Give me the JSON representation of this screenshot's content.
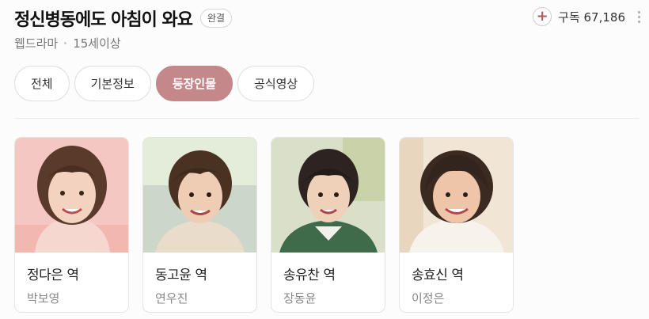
{
  "header": {
    "title": "정신병동에도 아침이 와요",
    "badge": "완결",
    "genre": "웹드라마",
    "rating": "15세이상",
    "subscribe_label": "구독 67,186",
    "subscribe_icon": "plus-icon",
    "more_icon": "more-vertical-icon"
  },
  "tabs": [
    {
      "label": "전체"
    },
    {
      "label": "기본정보"
    },
    {
      "label": "등장인물",
      "active": true
    },
    {
      "label": "공식영상"
    }
  ],
  "cast": [
    {
      "role": "정다은 역",
      "actor": "박보영"
    },
    {
      "role": "동고윤 역",
      "actor": "연우진"
    },
    {
      "role": "송유찬 역",
      "actor": "장동윤"
    },
    {
      "role": "송효신 역",
      "actor": "이정은"
    }
  ],
  "colors": {
    "accent": "#c4878a",
    "text_primary": "#222222",
    "text_secondary": "#888888"
  }
}
